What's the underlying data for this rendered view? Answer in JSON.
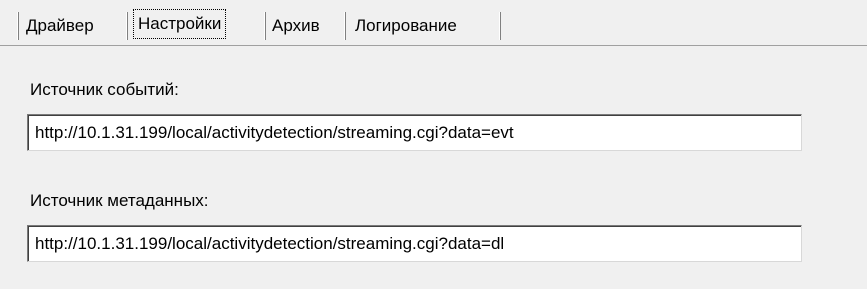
{
  "tabs": [
    {
      "label": "Драйвер",
      "active": false
    },
    {
      "label": "Настройки",
      "active": true
    },
    {
      "label": "Архив",
      "active": false
    },
    {
      "label": "Логирование",
      "active": false
    }
  ],
  "settings": {
    "events_source": {
      "label": "Источник событий:",
      "value": "http://10.1.31.199/local/activitydetection/streaming.cgi?data=evt"
    },
    "metadata_source": {
      "label": "Источник метаданных:",
      "value": "http://10.1.31.199/local/activitydetection/streaming.cgi?data=dl"
    }
  }
}
